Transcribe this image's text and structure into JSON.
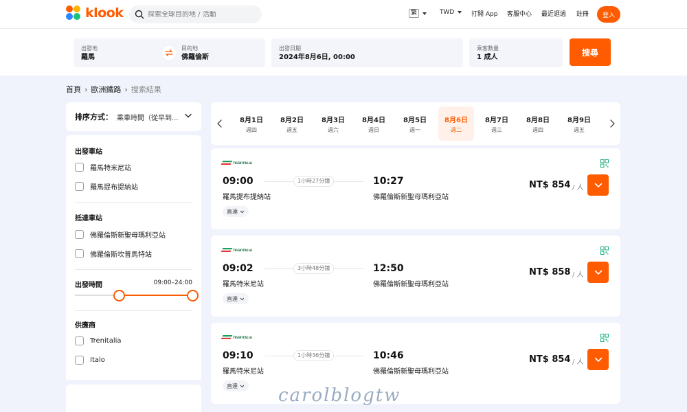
{
  "brand": {
    "name": "klook",
    "color": "#ff5b00"
  },
  "search": {
    "placeholder": "探索全球目的地 / 活動"
  },
  "nav": {
    "language": "繁",
    "currency": "TWD",
    "open_app": "打開 App",
    "help": "客服中心",
    "recent": "最近逛過",
    "signup": "註冊",
    "login": "登入"
  },
  "form": {
    "from_label": "出發地",
    "from_value": "羅馬",
    "to_label": "目的地",
    "to_value": "佛羅倫斯",
    "date_label": "出發日期",
    "date_value": "2024年8月6日, 00:00",
    "pax_label": "乘客數量",
    "pax_value": "1 成人",
    "search_button": "搜尋"
  },
  "breadcrumb": {
    "home": "首頁",
    "section": "歐洲鐵路",
    "current": "搜索結果"
  },
  "sort": {
    "label": "排序方式：",
    "value": "乘車時間（從早到..."
  },
  "filters": {
    "departure_title": "出發車站",
    "departure_stations": [
      "羅馬特米尼站",
      "羅馬提布提納站"
    ],
    "arrival_title": "抵達車站",
    "arrival_stations": [
      "佛羅倫斯新聖母瑪利亞站",
      "佛羅倫斯坎普馬特站"
    ],
    "time_title": "出發時間",
    "time_range": "09:00–24:00",
    "time_slider": {
      "min_hour": 0,
      "max_hour": 24,
      "from_hour": 9,
      "to_hour": 24
    },
    "supplier_title": "供應商",
    "suppliers": [
      "Trenitalia",
      "Italo"
    ]
  },
  "dates": [
    {
      "date": "8月1日",
      "weekday": "週四",
      "active": false
    },
    {
      "date": "8月2日",
      "weekday": "週五",
      "active": false
    },
    {
      "date": "8月3日",
      "weekday": "週六",
      "active": false
    },
    {
      "date": "8月4日",
      "weekday": "週日",
      "active": false
    },
    {
      "date": "8月5日",
      "weekday": "週一",
      "active": false
    },
    {
      "date": "8月6日",
      "weekday": "週二",
      "active": true
    },
    {
      "date": "8月7日",
      "weekday": "週三",
      "active": false
    },
    {
      "date": "8月8日",
      "weekday": "週四",
      "active": false
    },
    {
      "date": "8月9日",
      "weekday": "週五",
      "active": false
    }
  ],
  "results": [
    {
      "operator": "TRENITALIA",
      "dep_time": "09:00",
      "duration": "1小時27分鐘",
      "arr_time": "10:27",
      "dep_station": "羅馬提布提納站",
      "arr_station": "佛羅倫斯新聖母瑪利亞站",
      "tag": "直達",
      "price": "NT$ 854",
      "per": "/ 人"
    },
    {
      "operator": "TRENITALIA",
      "dep_time": "09:02",
      "duration": "3小時48分鐘",
      "arr_time": "12:50",
      "dep_station": "羅馬特米尼站",
      "arr_station": "佛羅倫斯新聖母瑪利亞站",
      "tag": "直達",
      "price": "NT$ 858",
      "per": "/ 人"
    },
    {
      "operator": "TRENITALIA",
      "dep_time": "09:10",
      "duration": "1小時36分鐘",
      "arr_time": "10:46",
      "dep_station": "羅馬特米尼站",
      "arr_station": "佛羅倫斯新聖母瑪利亞站",
      "tag": "直達",
      "price": "NT$ 854",
      "per": "/ 人"
    }
  ],
  "watermark": "carolblogtw"
}
